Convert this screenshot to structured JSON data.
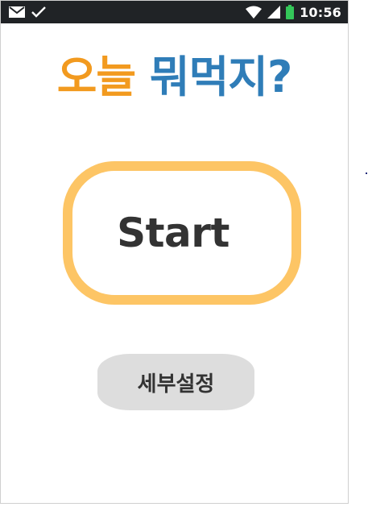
{
  "status_bar": {
    "left_icons": [
      "mail-icon",
      "check-icon"
    ],
    "right_icons": [
      "wifi-icon",
      "signal-icon",
      "battery-icon"
    ],
    "battery_color": "#34c759",
    "time": "10:56"
  },
  "title": {
    "part1": "오늘",
    "part2": "뭐먹지?",
    "colors": {
      "part1": "#f29a1f",
      "part2": "#2f7db8"
    }
  },
  "start_button": {
    "label": "Start",
    "border_color": "#fdc565"
  },
  "settings_button": {
    "label": "세부설정",
    "background": "#dddddd"
  }
}
